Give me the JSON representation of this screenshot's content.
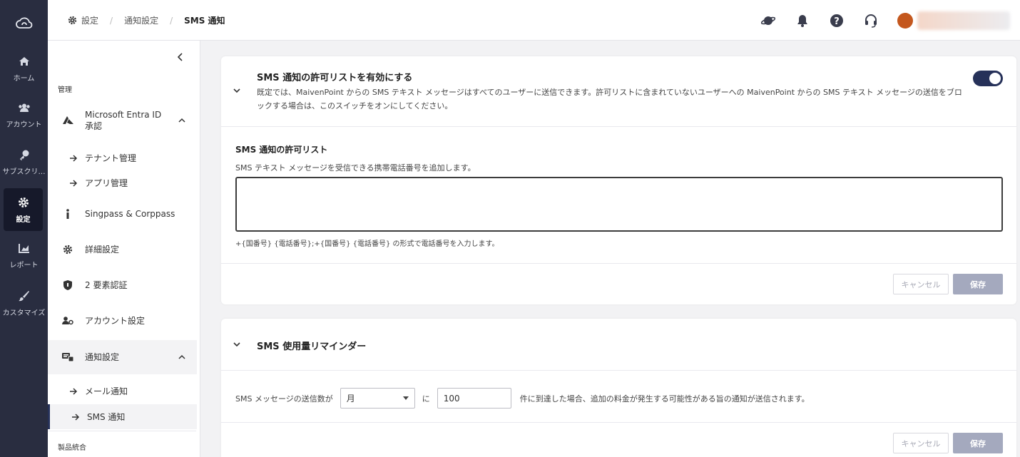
{
  "rail": {
    "items": [
      {
        "label": "ホーム",
        "icon": "home-icon"
      },
      {
        "label": "アカウント",
        "icon": "users-icon"
      },
      {
        "label": "サブスクリ…",
        "icon": "key-icon"
      },
      {
        "label": "設定",
        "icon": "gear-icon"
      },
      {
        "label": "レポート",
        "icon": "chart-icon"
      },
      {
        "label": "カスタマイズ",
        "icon": "brush-icon"
      }
    ],
    "active": "設定"
  },
  "breadcrumb": {
    "items": [
      "設定",
      "通知設定",
      "SMS 通知"
    ]
  },
  "header_icons": [
    "planet-icon",
    "bell-icon",
    "help-icon",
    "headset-icon",
    "avatar"
  ],
  "nav": {
    "section_manage": "管理",
    "items": {
      "entra": "Microsoft Entra ID 承認",
      "tenant": "テナント管理",
      "app": "アプリ管理",
      "singpass": "Singpass & Corppass",
      "advanced": "詳細設定",
      "twofa": "2 要素認証",
      "account": "アカウント設定",
      "notify": "通知設定",
      "mail": "メール通知",
      "sms": "SMS 通知"
    },
    "section_products": "製品統合"
  },
  "allowlist_card": {
    "title": "SMS 通知の許可リストを有効にする",
    "description": "既定では、MaivenPoint からの SMS テキスト メッセージはすべてのユーザーに送信できます。許可リストに含まれていないユーザーへの MaivenPoint からの SMS テキスト メッセージの送信をブロックする場合は、このスイッチをオンにしてください。",
    "toggle_on": true,
    "list_title": "SMS 通知の許可リスト",
    "list_hint": "SMS テキスト メッセージを受信できる携帯電話番号を追加します。",
    "textarea_value": "",
    "format_hint": "+{国番号} {電話番号};+{国番号} {電話番号} の形式で電話番号を入力します。",
    "cancel": "キャンセル",
    "save": "保存"
  },
  "reminder_card": {
    "title": "SMS 使用量リマインダー",
    "prefix": "SMS メッセージの送信数が",
    "period": "月",
    "ni": "に",
    "count": "100",
    "suffix": "件に到達した場合、追加の料金が発生する可能性がある旨の通知が送信されます。",
    "cancel": "キャンセル",
    "save": "保存"
  },
  "colors": {
    "rail_bg": "#292d40",
    "accent": "#263159",
    "save_disabled": "#a4a9be"
  }
}
